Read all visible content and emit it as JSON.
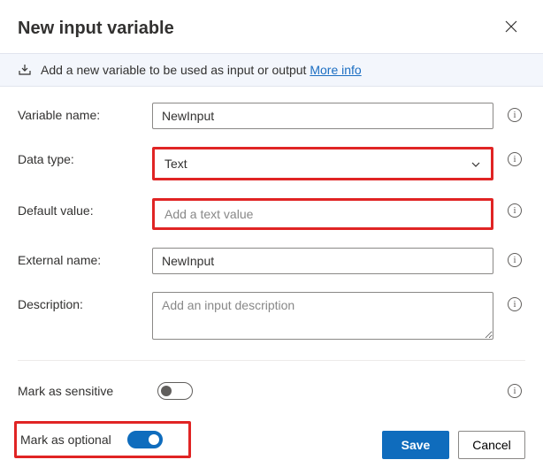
{
  "header": {
    "title": "New input variable"
  },
  "banner": {
    "text": "Add a new variable to be used as input or output ",
    "link": "More info"
  },
  "fields": {
    "variable_name": {
      "label": "Variable name:",
      "value": "NewInput"
    },
    "data_type": {
      "label": "Data type:",
      "value": "Text"
    },
    "default_value": {
      "label": "Default value:",
      "placeholder": "Add a text value"
    },
    "external_name": {
      "label": "External name:",
      "value": "NewInput"
    },
    "description": {
      "label": "Description:",
      "placeholder": "Add an input description"
    }
  },
  "toggles": {
    "sensitive": {
      "label": "Mark as sensitive",
      "on": false
    },
    "optional": {
      "label": "Mark as optional",
      "on": true
    }
  },
  "footer": {
    "save": "Save",
    "cancel": "Cancel"
  },
  "colors": {
    "primary": "#0f6cbd",
    "highlight": "#e02424",
    "banner_bg": "#f3f6fc"
  }
}
